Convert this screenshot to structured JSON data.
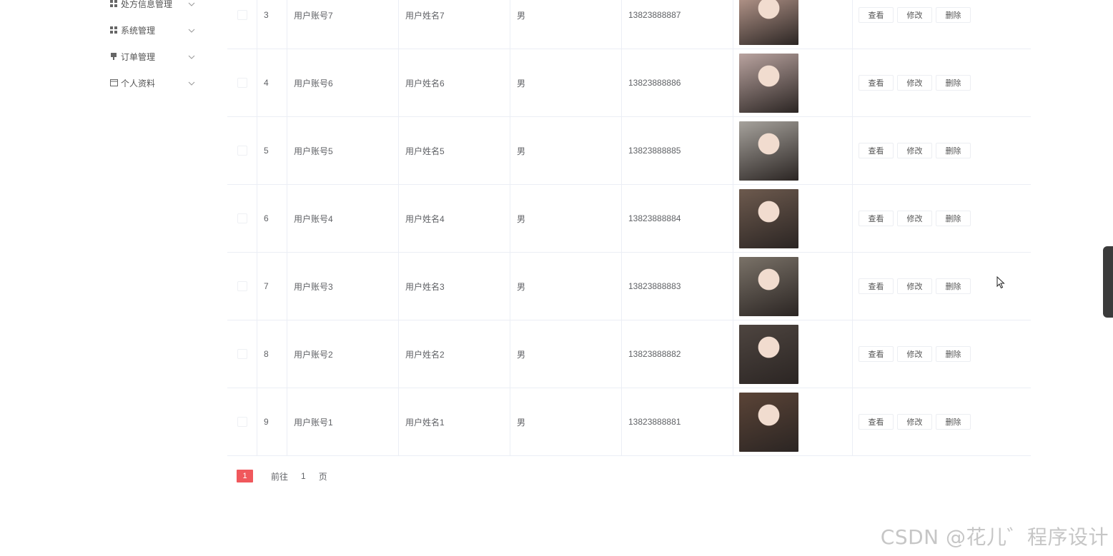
{
  "sidebar": {
    "items": [
      {
        "label": "处方信息管理",
        "icon": "grid-icon"
      },
      {
        "label": "系统管理",
        "icon": "grid-icon"
      },
      {
        "label": "订单管理",
        "icon": "pin-icon"
      },
      {
        "label": "个人资料",
        "icon": "calendar-icon"
      }
    ]
  },
  "table": {
    "rows": [
      {
        "index": "3",
        "account": "用户账号7",
        "name": "用户姓名7",
        "sex": "男",
        "phone": "13823888887",
        "photo_color": "#c9a79a"
      },
      {
        "index": "4",
        "account": "用户账号6",
        "name": "用户姓名6",
        "sex": "男",
        "phone": "13823888886",
        "photo_color": "#b9a39f"
      },
      {
        "index": "5",
        "account": "用户账号5",
        "name": "用户姓名5",
        "sex": "男",
        "phone": "13823888885",
        "photo_color": "#a6a29c"
      },
      {
        "index": "6",
        "account": "用户账号4",
        "name": "用户姓名4",
        "sex": "男",
        "phone": "13823888884",
        "photo_color": "#6d5a4e"
      },
      {
        "index": "7",
        "account": "用户账号3",
        "name": "用户姓名3",
        "sex": "男",
        "phone": "13823888883",
        "photo_color": "#7a7268"
      },
      {
        "index": "8",
        "account": "用户账号2",
        "name": "用户姓名2",
        "sex": "男",
        "phone": "13823888882",
        "photo_color": "#4e4540"
      },
      {
        "index": "9",
        "account": "用户账号1",
        "name": "用户姓名1",
        "sex": "男",
        "phone": "13823888881",
        "photo_color": "#5b4437"
      }
    ],
    "actions": {
      "view": "查看",
      "edit": "修改",
      "delete": "删除"
    }
  },
  "pagination": {
    "current_page": "1",
    "goto_label": "前往",
    "goto_value": "1",
    "goto_unit": "页"
  },
  "watermark": "CSDN @花儿゛程序设计"
}
